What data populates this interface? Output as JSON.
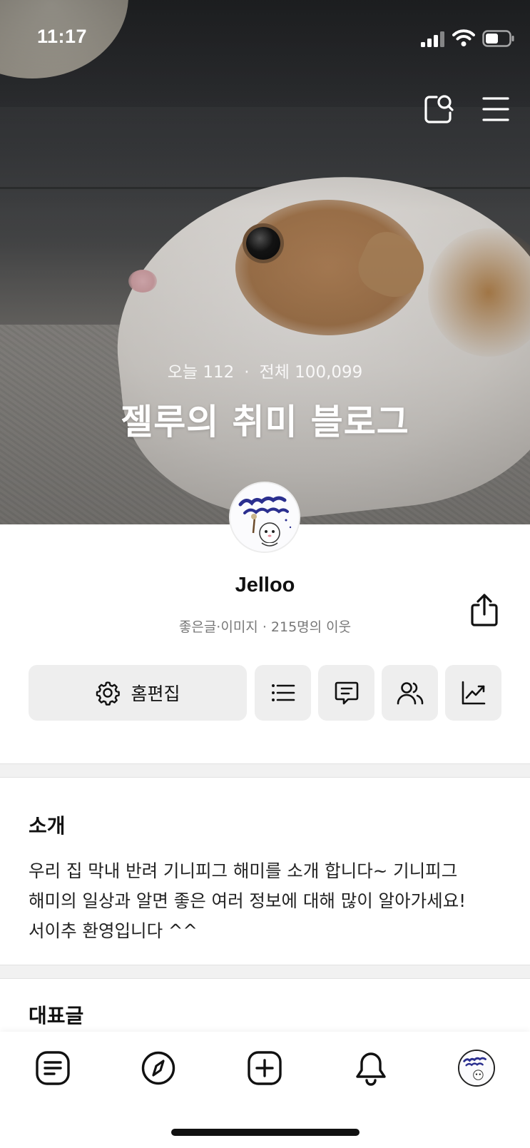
{
  "status_bar": {
    "time": "11:17",
    "signal_icon": "cellular-signal-icon",
    "wifi_icon": "wifi-icon",
    "battery_icon": "battery-icon"
  },
  "header": {
    "search_icon": "blog-search-icon",
    "menu_icon": "hamburger-menu-icon"
  },
  "hero": {
    "today_label": "오늘 112",
    "separator": "·",
    "total_label": "전체 100,099",
    "title": "젤루의 취미 블로그"
  },
  "profile": {
    "name": "Jelloo",
    "meta": "좋은글·이미지 · 215명의 이웃",
    "share_icon": "share-icon"
  },
  "actions": {
    "home_edit_label": "홈편집",
    "home_edit_icon": "gear-icon",
    "list_icon": "list-icon",
    "comment_icon": "comment-icon",
    "neighbor_icon": "neighbors-icon",
    "stats_icon": "stats-chart-icon"
  },
  "intro": {
    "title": "소개",
    "text": "우리 집 막내 반려 기니피그 해미를 소개 합니다~ 기니피그 해미의 일상과 알면 좋은 여러 정보에 대해 많이 알아가세요! 서이추 환영입니다 ^^"
  },
  "featured": {
    "title": "대표글"
  },
  "bottom_nav": {
    "items": [
      {
        "icon": "posts-icon"
      },
      {
        "icon": "compass-icon"
      },
      {
        "icon": "plus-square-icon"
      },
      {
        "icon": "bell-icon"
      },
      {
        "icon": "profile-avatar"
      }
    ]
  },
  "colors": {
    "button_bg": "#eeeeee",
    "divider": "#f1f1f1",
    "text": "#111111",
    "meta_text": "#777777"
  }
}
